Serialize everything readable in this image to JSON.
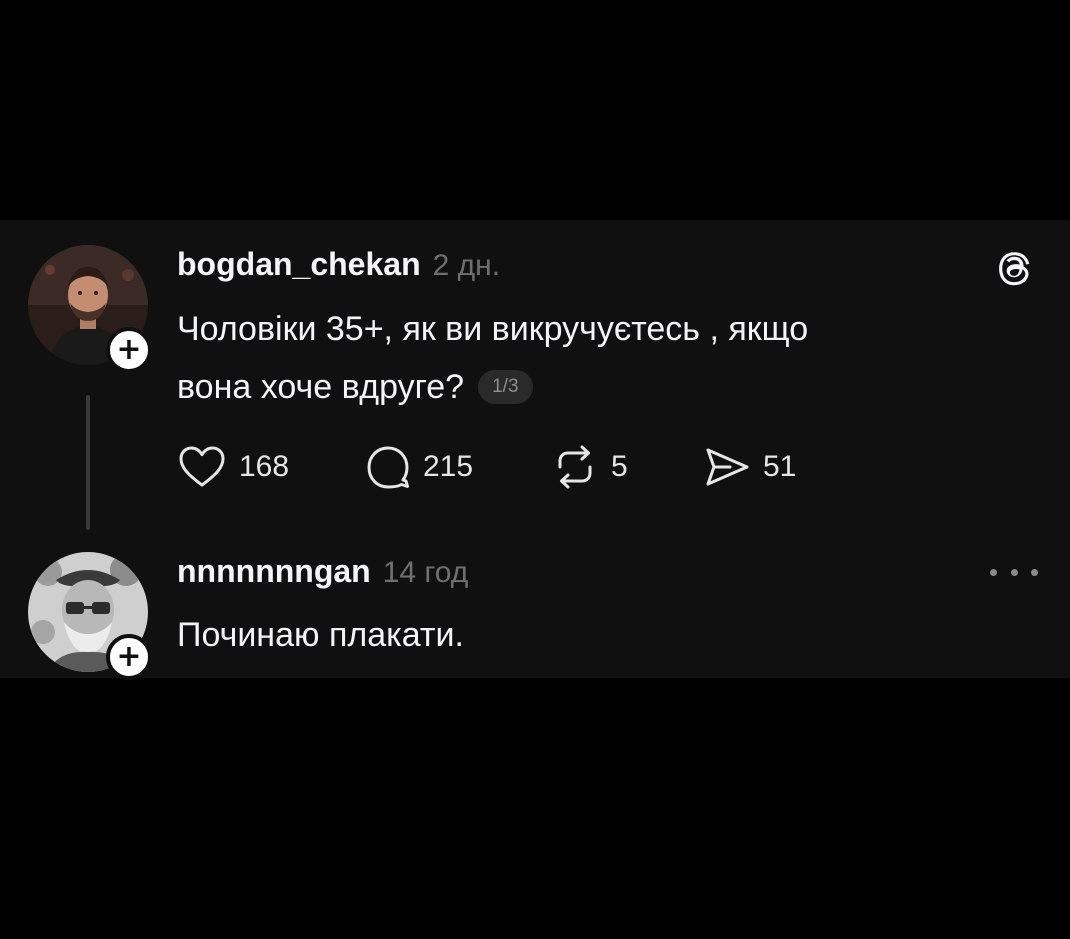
{
  "posts": [
    {
      "username": "bogdan_chekan",
      "time": "2 дн.",
      "text_line1": "Чоловіки 35+, як ви викручуєтесь , якщо",
      "text_line2": "вона хоче вдруге?",
      "page_indicator": "1/3",
      "actions": {
        "likes": "168",
        "comments": "215",
        "reposts": "5",
        "shares": "51"
      },
      "top_right_icon": "threads-logo-icon"
    },
    {
      "username": "nnnnnnngan",
      "time": "14 год",
      "text": "Починаю плакати.",
      "top_right_icon": "more-options-icon"
    }
  ],
  "colors": {
    "page_background": "#000000",
    "panel_background": "#101010",
    "primary_text": "#f3f5f7",
    "secondary_text": "#6f6f6f"
  }
}
